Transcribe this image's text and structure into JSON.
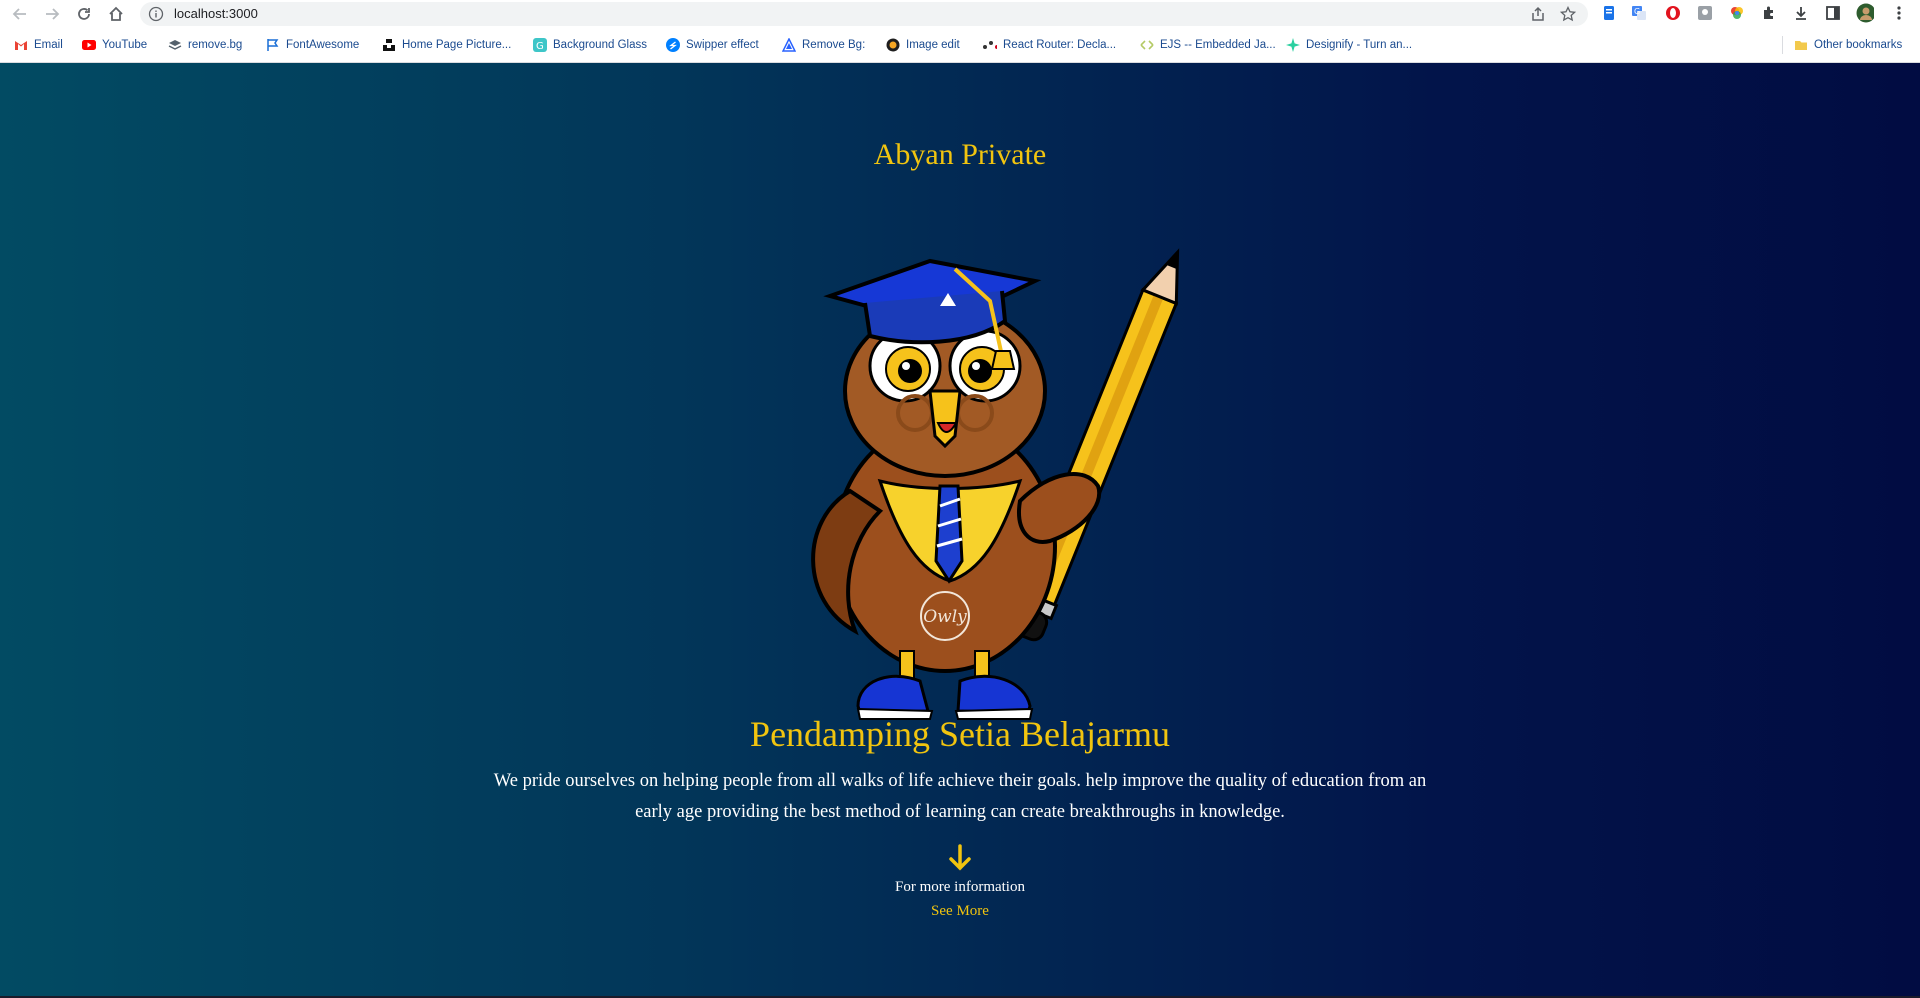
{
  "browser": {
    "url": "localhost:3000",
    "bookmarks": [
      {
        "label": "Email",
        "icon": "gmail-icon"
      },
      {
        "label": "YouTube",
        "icon": "youtube-icon"
      },
      {
        "label": "remove.bg",
        "icon": "removebg-icon"
      },
      {
        "label": "FontAwesome",
        "icon": "flag-icon"
      },
      {
        "label": "Home Page Picture...",
        "icon": "unsplash-icon"
      },
      {
        "label": "Background Glass",
        "icon": "glass-icon"
      },
      {
        "label": "Swipper effect",
        "icon": "swiper-icon"
      },
      {
        "label": "Remove Bg:",
        "icon": "triangle-icon"
      },
      {
        "label": "Image edit",
        "icon": "image-edit-icon"
      },
      {
        "label": "React Router: Decla...",
        "icon": "react-router-icon"
      },
      {
        "label": "EJS -- Embedded Ja...",
        "icon": "ejs-icon"
      },
      {
        "label": "Designify - Turn an...",
        "icon": "designify-icon"
      }
    ],
    "other_bookmarks": "Other bookmarks"
  },
  "hero": {
    "brand": "Abyan Private",
    "headline": "Pendamping Setia Belajarmu",
    "description": "We pride ourselves on helping people from all walks of life achieve their goals. help improve the quality of education from an early age providing the best method of learning can create breakthroughs in knowledge.",
    "more_info": "For more information",
    "see_more": "See More",
    "mascot_badge": "Owly"
  },
  "colors": {
    "accent": "#f1c40f",
    "gradient_left": "#024b63",
    "gradient_right": "#010c42"
  }
}
